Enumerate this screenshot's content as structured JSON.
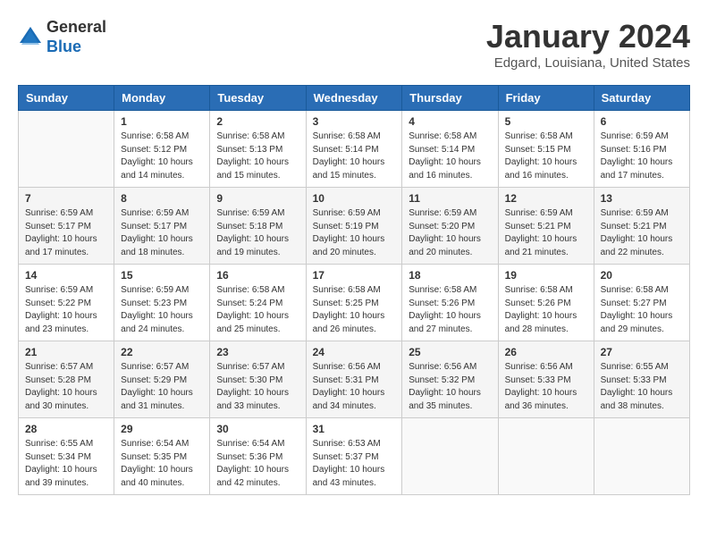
{
  "header": {
    "logo_general": "General",
    "logo_blue": "Blue",
    "month": "January 2024",
    "location": "Edgard, Louisiana, United States"
  },
  "weekdays": [
    "Sunday",
    "Monday",
    "Tuesday",
    "Wednesday",
    "Thursday",
    "Friday",
    "Saturday"
  ],
  "weeks": [
    [
      {
        "day": "",
        "info": ""
      },
      {
        "day": "1",
        "info": "Sunrise: 6:58 AM\nSunset: 5:12 PM\nDaylight: 10 hours\nand 14 minutes."
      },
      {
        "day": "2",
        "info": "Sunrise: 6:58 AM\nSunset: 5:13 PM\nDaylight: 10 hours\nand 15 minutes."
      },
      {
        "day": "3",
        "info": "Sunrise: 6:58 AM\nSunset: 5:14 PM\nDaylight: 10 hours\nand 15 minutes."
      },
      {
        "day": "4",
        "info": "Sunrise: 6:58 AM\nSunset: 5:14 PM\nDaylight: 10 hours\nand 16 minutes."
      },
      {
        "day": "5",
        "info": "Sunrise: 6:58 AM\nSunset: 5:15 PM\nDaylight: 10 hours\nand 16 minutes."
      },
      {
        "day": "6",
        "info": "Sunrise: 6:59 AM\nSunset: 5:16 PM\nDaylight: 10 hours\nand 17 minutes."
      }
    ],
    [
      {
        "day": "7",
        "info": "Sunrise: 6:59 AM\nSunset: 5:17 PM\nDaylight: 10 hours\nand 17 minutes."
      },
      {
        "day": "8",
        "info": "Sunrise: 6:59 AM\nSunset: 5:17 PM\nDaylight: 10 hours\nand 18 minutes."
      },
      {
        "day": "9",
        "info": "Sunrise: 6:59 AM\nSunset: 5:18 PM\nDaylight: 10 hours\nand 19 minutes."
      },
      {
        "day": "10",
        "info": "Sunrise: 6:59 AM\nSunset: 5:19 PM\nDaylight: 10 hours\nand 20 minutes."
      },
      {
        "day": "11",
        "info": "Sunrise: 6:59 AM\nSunset: 5:20 PM\nDaylight: 10 hours\nand 20 minutes."
      },
      {
        "day": "12",
        "info": "Sunrise: 6:59 AM\nSunset: 5:21 PM\nDaylight: 10 hours\nand 21 minutes."
      },
      {
        "day": "13",
        "info": "Sunrise: 6:59 AM\nSunset: 5:21 PM\nDaylight: 10 hours\nand 22 minutes."
      }
    ],
    [
      {
        "day": "14",
        "info": "Sunrise: 6:59 AM\nSunset: 5:22 PM\nDaylight: 10 hours\nand 23 minutes."
      },
      {
        "day": "15",
        "info": "Sunrise: 6:59 AM\nSunset: 5:23 PM\nDaylight: 10 hours\nand 24 minutes."
      },
      {
        "day": "16",
        "info": "Sunrise: 6:58 AM\nSunset: 5:24 PM\nDaylight: 10 hours\nand 25 minutes."
      },
      {
        "day": "17",
        "info": "Sunrise: 6:58 AM\nSunset: 5:25 PM\nDaylight: 10 hours\nand 26 minutes."
      },
      {
        "day": "18",
        "info": "Sunrise: 6:58 AM\nSunset: 5:26 PM\nDaylight: 10 hours\nand 27 minutes."
      },
      {
        "day": "19",
        "info": "Sunrise: 6:58 AM\nSunset: 5:26 PM\nDaylight: 10 hours\nand 28 minutes."
      },
      {
        "day": "20",
        "info": "Sunrise: 6:58 AM\nSunset: 5:27 PM\nDaylight: 10 hours\nand 29 minutes."
      }
    ],
    [
      {
        "day": "21",
        "info": "Sunrise: 6:57 AM\nSunset: 5:28 PM\nDaylight: 10 hours\nand 30 minutes."
      },
      {
        "day": "22",
        "info": "Sunrise: 6:57 AM\nSunset: 5:29 PM\nDaylight: 10 hours\nand 31 minutes."
      },
      {
        "day": "23",
        "info": "Sunrise: 6:57 AM\nSunset: 5:30 PM\nDaylight: 10 hours\nand 33 minutes."
      },
      {
        "day": "24",
        "info": "Sunrise: 6:56 AM\nSunset: 5:31 PM\nDaylight: 10 hours\nand 34 minutes."
      },
      {
        "day": "25",
        "info": "Sunrise: 6:56 AM\nSunset: 5:32 PM\nDaylight: 10 hours\nand 35 minutes."
      },
      {
        "day": "26",
        "info": "Sunrise: 6:56 AM\nSunset: 5:33 PM\nDaylight: 10 hours\nand 36 minutes."
      },
      {
        "day": "27",
        "info": "Sunrise: 6:55 AM\nSunset: 5:33 PM\nDaylight: 10 hours\nand 38 minutes."
      }
    ],
    [
      {
        "day": "28",
        "info": "Sunrise: 6:55 AM\nSunset: 5:34 PM\nDaylight: 10 hours\nand 39 minutes."
      },
      {
        "day": "29",
        "info": "Sunrise: 6:54 AM\nSunset: 5:35 PM\nDaylight: 10 hours\nand 40 minutes."
      },
      {
        "day": "30",
        "info": "Sunrise: 6:54 AM\nSunset: 5:36 PM\nDaylight: 10 hours\nand 42 minutes."
      },
      {
        "day": "31",
        "info": "Sunrise: 6:53 AM\nSunset: 5:37 PM\nDaylight: 10 hours\nand 43 minutes."
      },
      {
        "day": "",
        "info": ""
      },
      {
        "day": "",
        "info": ""
      },
      {
        "day": "",
        "info": ""
      }
    ]
  ]
}
